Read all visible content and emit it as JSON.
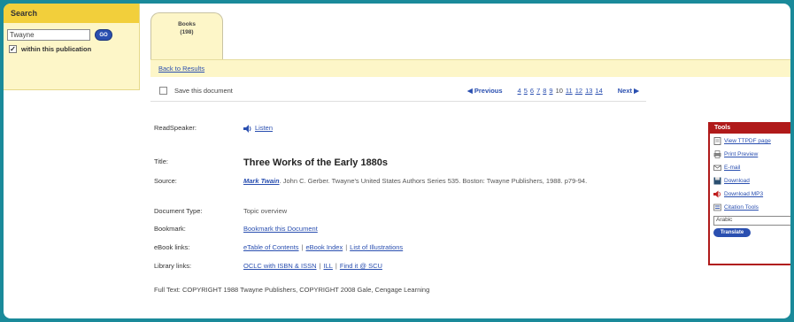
{
  "search": {
    "header": "Search",
    "input_value": "Twayne",
    "go_label": "GO",
    "within_label": "within this publication",
    "within_checked": "✓"
  },
  "tab": {
    "line1": "Books",
    "line2": "(198)"
  },
  "results": {
    "back_label": "Back to Results"
  },
  "toolbar": {
    "save_label": "Save this document",
    "prev_label": "◀ Previous",
    "pages": [
      "4",
      "5",
      "6",
      "7",
      "8",
      "9",
      "10",
      "11",
      "12",
      "13",
      "14"
    ],
    "current_page": "10",
    "next_label": "Next ▶"
  },
  "record": {
    "readspeaker_label": "ReadSpeaker:",
    "listen_label": "Listen",
    "title_label": "Title:",
    "title_value": "Three Works of the Early 1880s",
    "source_label": "Source:",
    "source_link": "Mark Twain",
    "source_text": ". John C. Gerber. Twayne's United States Authors Series 535. Boston: Twayne Publishers, 1988. p79-94.",
    "doctype_label": "Document Type:",
    "doctype_value": "Topic overview",
    "bookmark_label": "Bookmark:",
    "bookmark_value": "Bookmark this Document",
    "ebook_label": "eBook links:",
    "ebook_links": [
      "eTable of Contents",
      "eBook Index",
      "List of Illustrations"
    ],
    "library_label": "Library links:",
    "library_links": [
      "OCLC with ISBN & ISSN",
      "ILL",
      "Find it @ SCU"
    ],
    "fulltext": "Full Text: COPYRIGHT 1988 Twayne Publishers, COPYRIGHT 2008 Gale, Cengage Learning"
  },
  "tools": {
    "header": "Tools",
    "items": [
      {
        "label": "View TTPDF page",
        "icon": "page-icon"
      },
      {
        "label": "Print Preview",
        "icon": "printer-icon"
      },
      {
        "label": "E-mail",
        "icon": "email-icon"
      },
      {
        "label": "Download",
        "icon": "download-icon"
      },
      {
        "label": "Download MP3",
        "icon": "speaker-icon"
      },
      {
        "label": "Citation Tools",
        "icon": "citation-icon"
      }
    ],
    "language_value": "Arabic",
    "translate_label": "Translate"
  },
  "colors": {
    "background": "#1a8a9a",
    "panel": "#fdf6c8",
    "panel_header": "#f2cf3b",
    "link": "#2a4fb0",
    "tools_border": "#b01a1a"
  }
}
